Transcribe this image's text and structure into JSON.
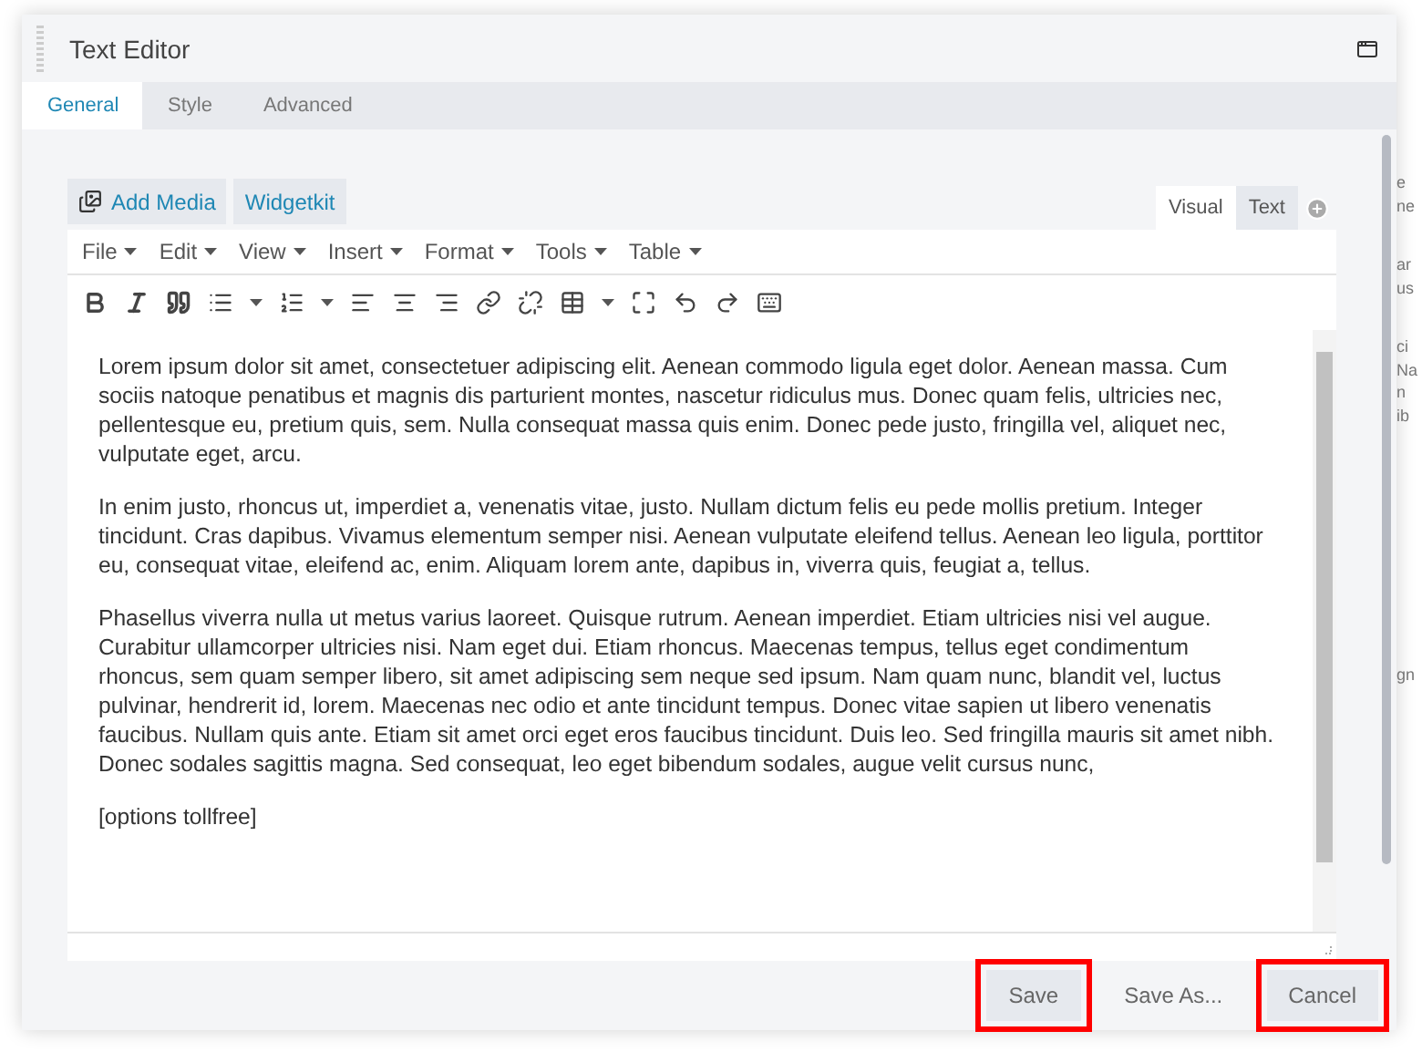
{
  "window": {
    "title": "Text Editor"
  },
  "tabs": [
    {
      "label": "General",
      "selected": true
    },
    {
      "label": "Style",
      "selected": false
    },
    {
      "label": "Advanced",
      "selected": false
    }
  ],
  "media_buttons": [
    "Add Media",
    "Widgetkit"
  ],
  "editor_modes": [
    {
      "label": "Visual",
      "selected": true
    },
    {
      "label": "Text",
      "selected": false
    }
  ],
  "menu": [
    "File",
    "Edit",
    "View",
    "Insert",
    "Format",
    "Tools",
    "Table"
  ],
  "paragraphs": [
    "Lorem ipsum dolor sit amet, consectetuer adipiscing elit. Aenean commodo ligula eget dolor. Aenean massa. Cum sociis natoque penatibus et magnis dis parturient montes, nascetur ridiculus mus. Donec quam felis, ultricies nec, pellentesque eu, pretium quis, sem. Nulla consequat massa quis enim. Donec pede justo, fringilla vel, aliquet nec, vulputate eget, arcu.",
    "In enim justo, rhoncus ut, imperdiet a, venenatis vitae, justo. Nullam dictum felis eu pede mollis pretium. Integer tincidunt. Cras dapibus. Vivamus elementum semper nisi. Aenean vulputate eleifend tellus. Aenean leo ligula, porttitor eu, consequat vitae, eleifend ac, enim. Aliquam lorem ante, dapibus in, viverra quis, feugiat a, tellus.",
    "Phasellus viverra nulla ut metus varius laoreet. Quisque rutrum. Aenean imperdiet. Etiam ultricies nisi vel augue. Curabitur ullamcorper ultricies nisi. Nam eget dui. Etiam rhoncus. Maecenas tempus, tellus eget condimentum rhoncus, sem quam semper libero, sit amet adipiscing sem neque sed ipsum. Nam quam nunc, blandit vel, luctus pulvinar, hendrerit id, lorem. Maecenas nec odio et ante tincidunt tempus. Donec vitae sapien ut libero venenatis faucibus. Nullam quis ante. Etiam sit amet orci eget eros faucibus tincidunt. Duis leo. Sed fringilla mauris sit amet nibh. Donec sodales sagittis magna. Sed consequat, leo eget bibendum sodales, augue velit cursus nunc,",
    "[options tollfree]"
  ],
  "footer_buttons": [
    {
      "label": "Save",
      "highlighted": true
    },
    {
      "label": "Save As...",
      "highlighted": false
    },
    {
      "label": "Cancel",
      "highlighted": true
    }
  ],
  "background_fragments": [
    [
      "e",
      "ne"
    ],
    [
      "ar",
      "us"
    ],
    [
      "ci",
      "Na",
      "n",
      "ib"
    ],
    [
      "gn"
    ]
  ]
}
